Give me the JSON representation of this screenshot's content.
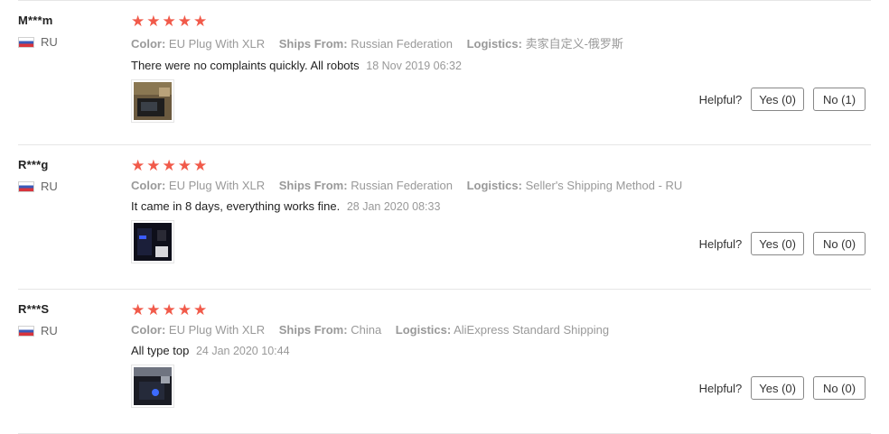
{
  "helpful_label": "Helpful?",
  "reviews": [
    {
      "user": "M***m",
      "country": "RU",
      "stars": 5,
      "color_key": "Color:",
      "color_val": "EU Plug With XLR",
      "ships_key": "Ships From:",
      "ships_val": "Russian Federation",
      "logistics_key": "Logistics:",
      "logistics_val": "卖家自定义-俄罗斯",
      "text": "There were no complaints quickly. All robots",
      "date": "18 Nov 2019 06:32",
      "yes": "Yes (0)",
      "no": "No (1)"
    },
    {
      "user": "R***g",
      "country": "RU",
      "stars": 5,
      "color_key": "Color:",
      "color_val": "EU Plug With XLR",
      "ships_key": "Ships From:",
      "ships_val": "Russian Federation",
      "logistics_key": "Logistics:",
      "logistics_val": "Seller's Shipping Method - RU",
      "text": "It came in 8 days, everything works fine.",
      "date": "28 Jan 2020 08:33",
      "yes": "Yes (0)",
      "no": "No (0)"
    },
    {
      "user": "R***S",
      "country": "RU",
      "stars": 5,
      "color_key": "Color:",
      "color_val": "EU Plug With XLR",
      "ships_key": "Ships From:",
      "ships_val": "China",
      "logistics_key": "Logistics:",
      "logistics_val": "AliExpress Standard Shipping",
      "text": "All type top",
      "date": "24 Jan 2020 10:44",
      "yes": "Yes (0)",
      "no": "No (0)"
    }
  ],
  "colors": {
    "star": "#f15a4a",
    "muted": "#999999"
  }
}
